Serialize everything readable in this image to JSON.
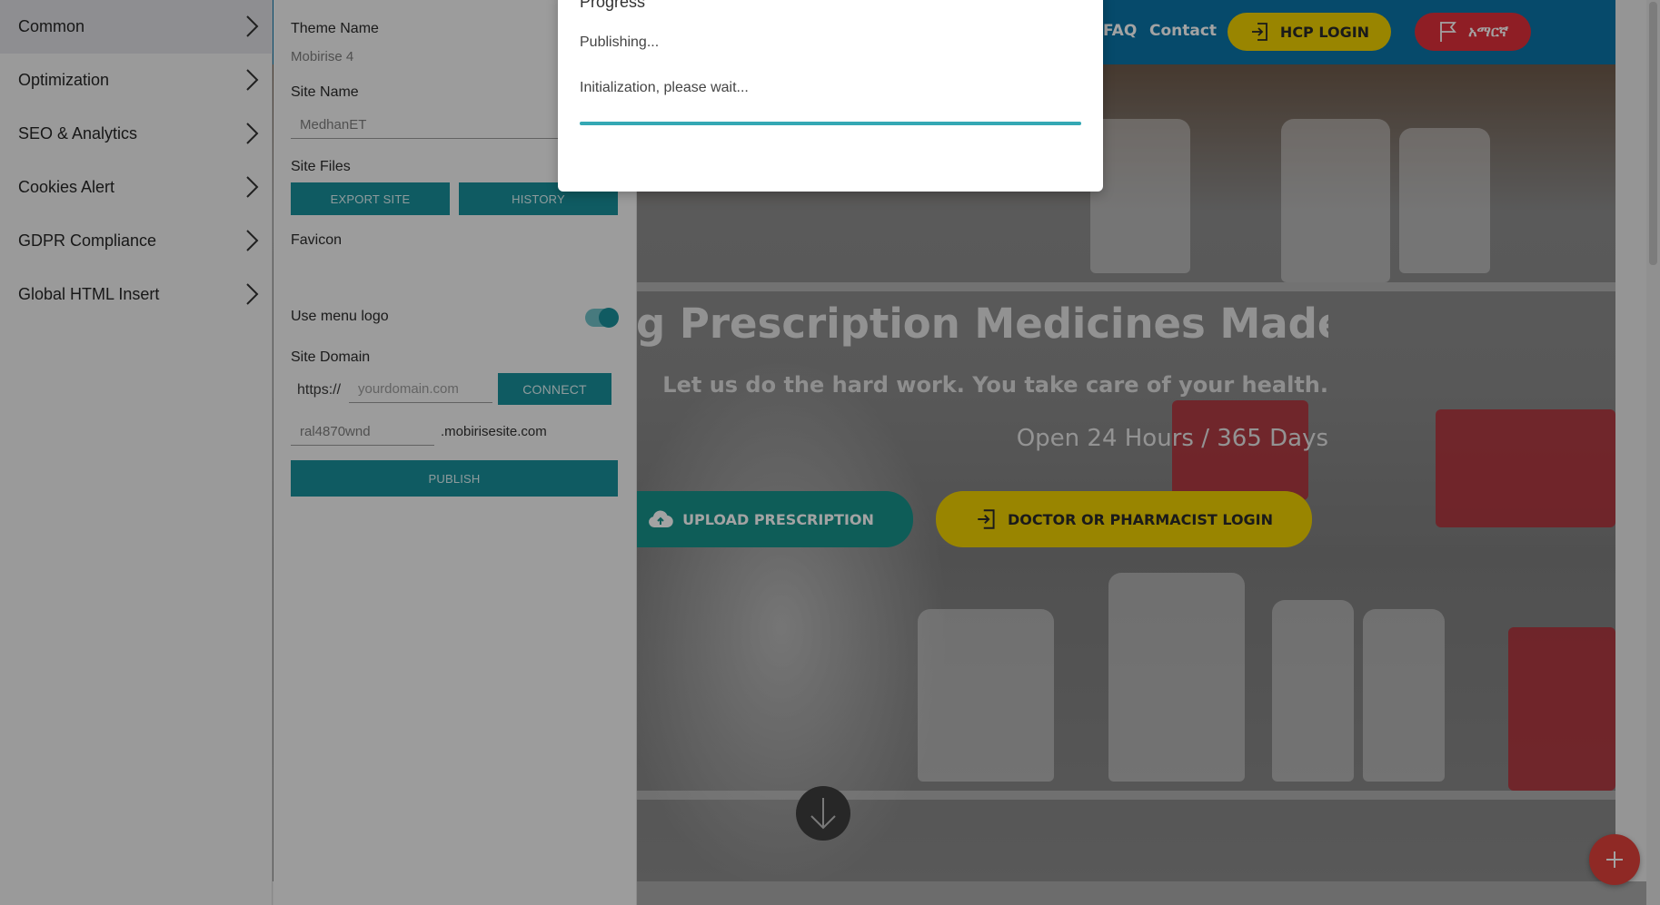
{
  "site": {
    "nav": {
      "faq": "FAQ",
      "contact": "Contact"
    },
    "hcp_login_label": "HCP LOGIN",
    "language_label": "አማርኛ",
    "hero": {
      "title": "g Prescription Medicines Made Easy.",
      "subtitle": "Let us do the hard work. You take care of your health.",
      "hours": "Open 24 Hours / 365 Days",
      "upload_label": "UPLOAD PRESCRIPTION",
      "doctor_login_label": "DOCTOR OR PHARMACIST LOGIN"
    },
    "colors": {
      "header": "#0a75a8",
      "yellow": "#f0d000",
      "red": "#e0303a",
      "teal": "#16928a"
    }
  },
  "sidebar": {
    "items": [
      {
        "label": "Common",
        "active": true
      },
      {
        "label": "Optimization",
        "active": false
      },
      {
        "label": "SEO & Analytics",
        "active": false
      },
      {
        "label": "Cookies Alert",
        "active": false
      },
      {
        "label": "GDPR Compliance",
        "active": false
      },
      {
        "label": "Global HTML Insert",
        "active": false
      }
    ]
  },
  "settings": {
    "theme_name_label": "Theme Name",
    "theme_name_value": "Mobirise 4",
    "site_name_label": "Site Name",
    "site_name_value": "MedhanET",
    "site_files_label": "Site Files",
    "export_label": "EXPORT SITE",
    "history_label": "HISTORY",
    "favicon_label": "Favicon",
    "menu_logo_label": "Use menu logo",
    "menu_logo_enabled": true,
    "site_domain_label": "Site Domain",
    "protocol": "https://",
    "domain_placeholder": "yourdomain.com",
    "connect_label": "CONNECT",
    "subdomain_value": "ral4870wnd",
    "subdomain_suffix": ".mobirisesite.com",
    "publish_label": "PUBLISH",
    "accent_color": "#188f9a"
  },
  "modal": {
    "title": "Progress",
    "status": "Publishing...",
    "message": "Initialization, please wait...",
    "progress": 1.0
  }
}
